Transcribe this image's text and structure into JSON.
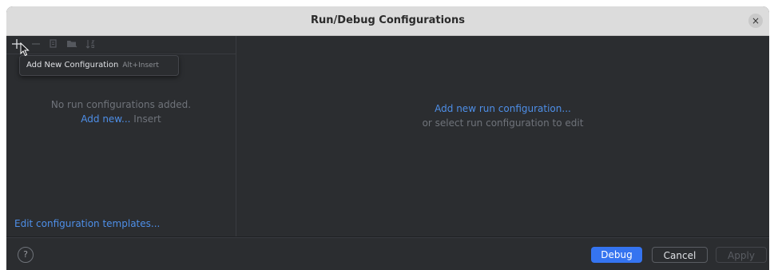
{
  "window": {
    "title": "Run/Debug Configurations",
    "close_glyph": "×"
  },
  "toolbar": {
    "icons": [
      "plus-icon",
      "minus-icon",
      "copy-icon",
      "folder-icon",
      "sort-icon"
    ]
  },
  "tooltip": {
    "label": "Add New Configuration",
    "shortcut": "Alt+Insert"
  },
  "left_panel": {
    "empty_message": "No run configurations added.",
    "add_new_link": "Add new...",
    "add_new_hint": "Insert",
    "templates_link": "Edit configuration templates..."
  },
  "right_panel": {
    "add_link": "Add new run configuration...",
    "subtext": "or select run configuration to edit"
  },
  "footer": {
    "help_glyph": "?",
    "debug_label": "Debug",
    "cancel_label": "Cancel",
    "apply_label": "Apply"
  },
  "colors": {
    "accent": "#3574f0",
    "link": "#4e8fe8",
    "panel_bg": "#2b2d30",
    "muted_text": "#6f737a"
  }
}
